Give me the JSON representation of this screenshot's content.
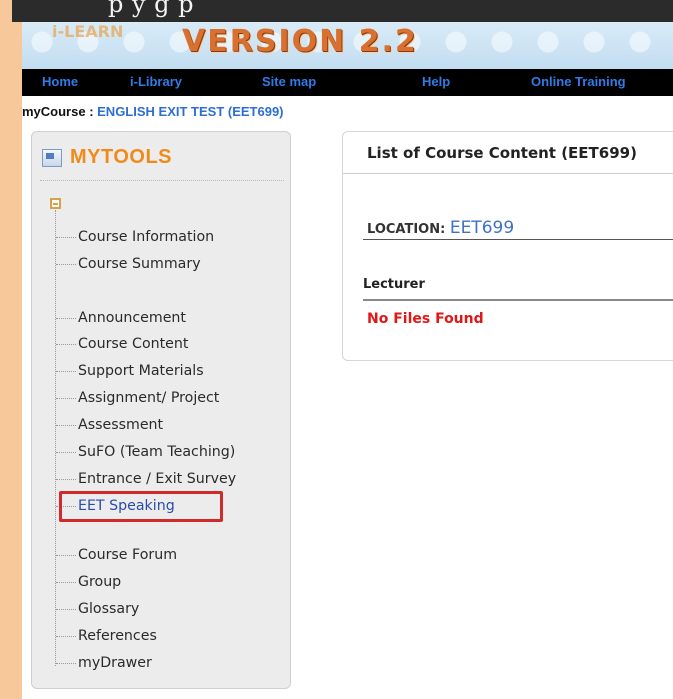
{
  "top_caption": "p       y      g p",
  "banner": {
    "logo_text": "i-LEARN",
    "version_text": "VERSION 2.2"
  },
  "nav": {
    "items": [
      {
        "label": "Home"
      },
      {
        "label": "i-Library"
      },
      {
        "label": "Site map"
      },
      {
        "label": "Help"
      },
      {
        "label": "Online Training"
      }
    ]
  },
  "breadcrumb": {
    "label": "myCourse : ",
    "course": "ENGLISH EXIT TEST (EET699)"
  },
  "mytools": {
    "title": "MYTOOLS",
    "items": [
      {
        "label": "Course Information"
      },
      {
        "label": "Course Summary"
      },
      {
        "label": "Announcement"
      },
      {
        "label": "Course Content"
      },
      {
        "label": "Support Materials"
      },
      {
        "label": "Assignment/ Project"
      },
      {
        "label": "Assessment"
      },
      {
        "label": "SuFO (Team Teaching)"
      },
      {
        "label": "Entrance / Exit Survey"
      },
      {
        "label": "EET Speaking"
      },
      {
        "label": "Course Forum"
      },
      {
        "label": "Group"
      },
      {
        "label": "Glossary"
      },
      {
        "label": "References"
      },
      {
        "label": "myDrawer"
      }
    ],
    "highlighted_item": "EET Speaking",
    "highlight_color": "#d12a2a"
  },
  "content_panel": {
    "title": "List of Course Content (EET699)",
    "location_label": "LOCATION: ",
    "location_value": "EET699",
    "lecturer_header": "Lecturer",
    "empty_message": "No Files Found"
  },
  "colors": {
    "accent_orange": "#f08b1a",
    "link_blue": "#2c6fd1",
    "nav_bg": "#000000",
    "error_red": "#e01717"
  },
  "icons": [
    "mytools-icon",
    "tree-expand-icon"
  ]
}
